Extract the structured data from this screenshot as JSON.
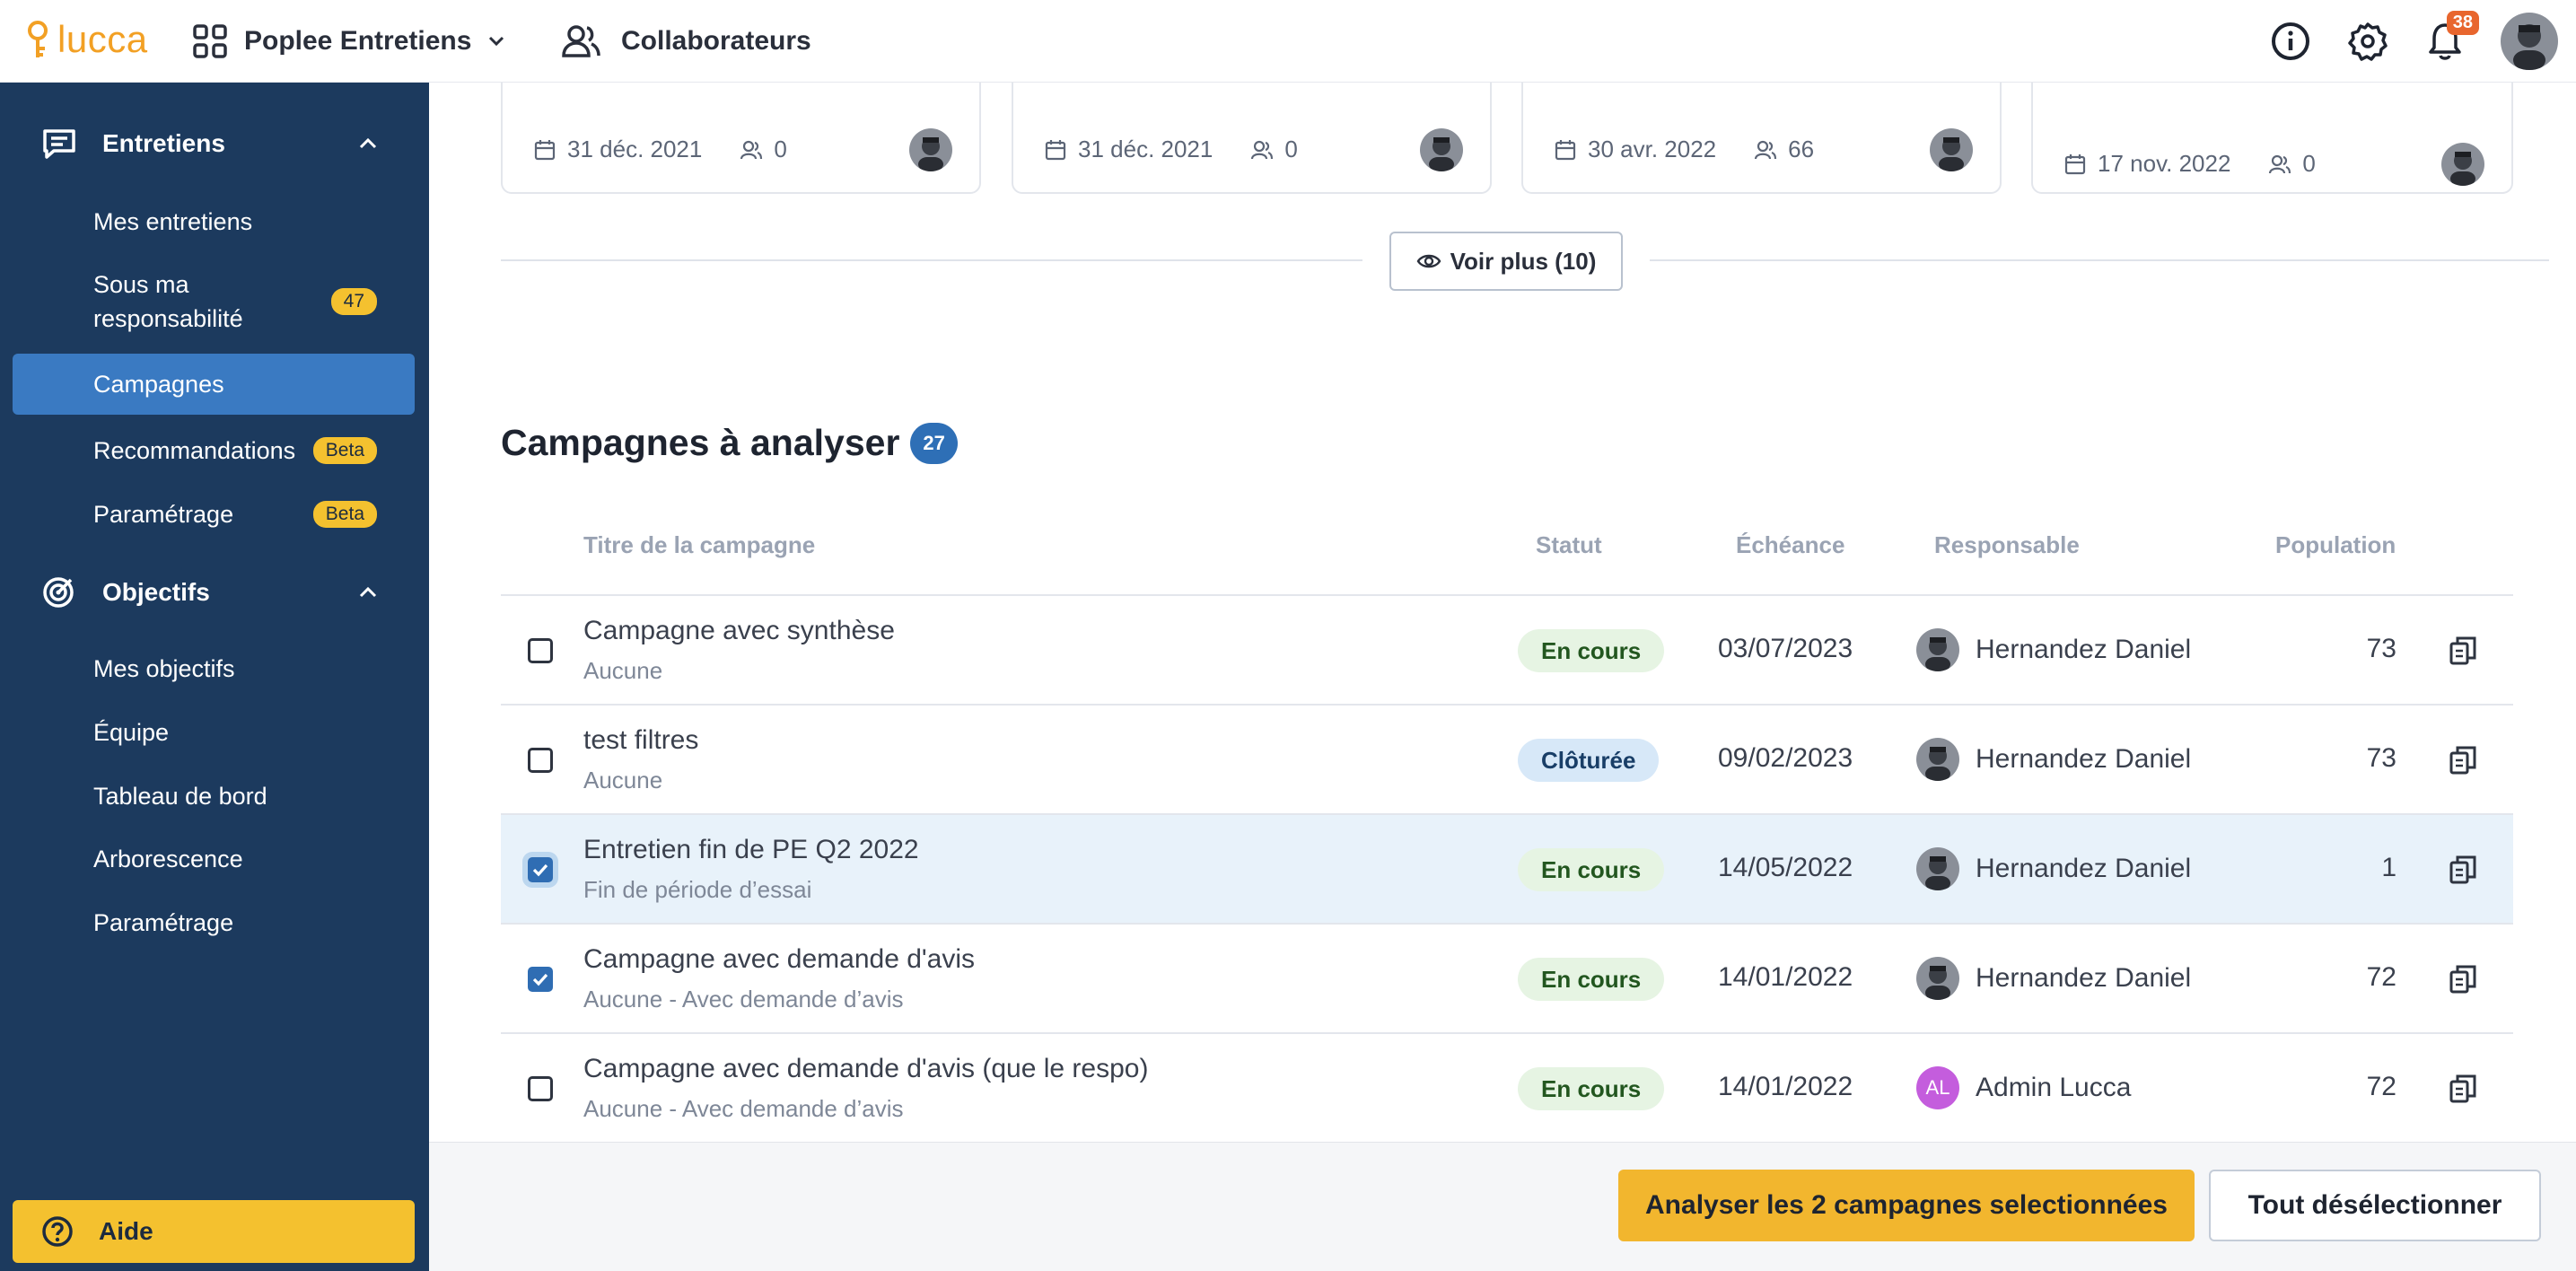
{
  "app": {
    "logo_text": "lucca",
    "name": "Poplee Entretiens",
    "collaborateurs_label": "Collaborateurs",
    "notifications_count": "38"
  },
  "sidebar": {
    "sections": [
      {
        "label": "Entretiens",
        "icon": "chat-icon"
      },
      {
        "label": "Objectifs",
        "icon": "target-icon"
      }
    ],
    "entretiens_items": [
      {
        "label": "Mes entretiens",
        "badge": ""
      },
      {
        "label": "Sous ma\nresponsabilité",
        "badge": "47"
      },
      {
        "label": "Campagnes",
        "badge": "",
        "active": true
      },
      {
        "label": "Recommandations",
        "badge": "Beta"
      },
      {
        "label": "Paramétrage",
        "badge": "Beta"
      }
    ],
    "objectifs_items": [
      {
        "label": "Mes objectifs"
      },
      {
        "label": "Équipe"
      },
      {
        "label": "Tableau de bord"
      },
      {
        "label": "Arborescence"
      },
      {
        "label": "Paramétrage"
      }
    ],
    "aide_label": "Aide"
  },
  "cards": [
    {
      "date": "31 déc. 2021",
      "participants": "0"
    },
    {
      "date": "31 déc. 2021",
      "participants": "0"
    },
    {
      "date": "30 avr. 2022",
      "participants": "66"
    },
    {
      "date": "17 nov. 2022",
      "participants": "0"
    }
  ],
  "voir_plus_label": "Voir plus (10)",
  "section": {
    "title": "Campagnes à analyser",
    "count": "27"
  },
  "table": {
    "headers": {
      "title": "Titre de la campagne",
      "status": "Statut",
      "due": "Échéance",
      "owner": "Responsable",
      "population": "Population"
    },
    "rows": [
      {
        "title": "Campagne avec synthèse",
        "sub": "Aucune",
        "status": "En cours",
        "status_kind": "green",
        "date": "03/07/2023",
        "owner": "Hernandez Daniel",
        "owner_initials": "",
        "population": "73",
        "checked": false,
        "selected": false
      },
      {
        "title": "test filtres",
        "sub": "Aucune",
        "status": "Clôturée",
        "status_kind": "blue",
        "date": "09/02/2023",
        "owner": "Hernandez Daniel",
        "owner_initials": "",
        "population": "73",
        "checked": false,
        "selected": false
      },
      {
        "title": "Entretien fin de PE Q2 2022",
        "sub": "Fin de période d’essai",
        "status": "En cours",
        "status_kind": "green",
        "date": "14/05/2022",
        "owner": "Hernandez Daniel",
        "owner_initials": "",
        "population": "1",
        "checked": true,
        "selected": true
      },
      {
        "title": "Campagne avec demande d'avis",
        "sub": "Aucune - Avec demande d’avis",
        "status": "En cours",
        "status_kind": "green",
        "date": "14/01/2022",
        "owner": "Hernandez Daniel",
        "owner_initials": "",
        "population": "72",
        "checked": true,
        "selected": false
      },
      {
        "title": "Campagne avec demande d'avis (que le respo)",
        "sub": "Aucune - Avec demande d’avis",
        "status": "En cours",
        "status_kind": "green",
        "date": "14/01/2022",
        "owner": "Admin Lucca",
        "owner_initials": "AL",
        "population": "72",
        "checked": false,
        "selected": false
      }
    ]
  },
  "actions": {
    "analyse_label": "Analyser les 2 campagnes selectionnées",
    "deselect_label": "Tout désélectionner"
  },
  "colors": {
    "sidebar_bg": "#1c3a5e",
    "active_item": "#3a7ac2",
    "accent_yellow": "#f2b62e",
    "brand_orange": "#f2a024",
    "badge_blue": "#2e6fb6"
  }
}
